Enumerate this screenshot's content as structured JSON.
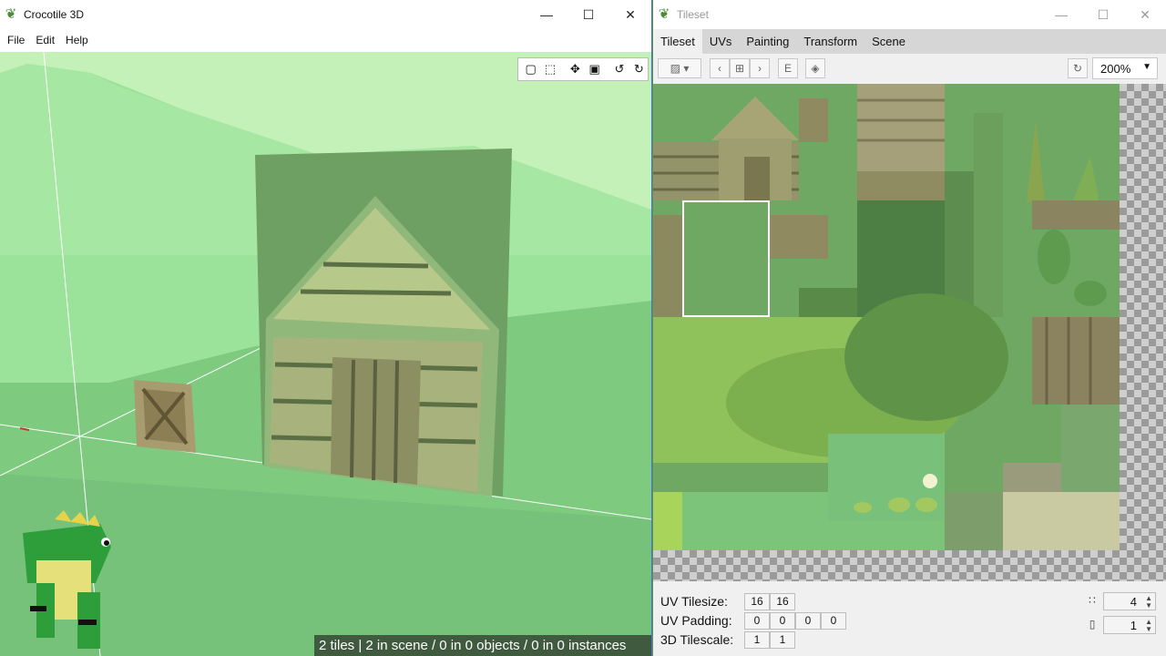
{
  "left_window": {
    "title": "Crocotile 3D",
    "menu": [
      "File",
      "Edit",
      "Help"
    ],
    "window_buttons": [
      "minimize-icon",
      "maximize-icon",
      "close-icon"
    ],
    "viewport_tools": [
      "square-icon",
      "cube-icon",
      "move-icon",
      "fill-square-icon",
      "rotate-ccw-icon",
      "rotate-cw-icon"
    ],
    "status": "2 tiles | 2 in scene / 0 in 0 objects / 0 in 0 instances",
    "colors": {
      "sky": "#9be39a",
      "ground": "#7ecb80",
      "status_bg": "#3f5a3f"
    }
  },
  "right_window": {
    "title": "Tileset",
    "window_buttons": [
      "minimize-icon",
      "maximize-icon",
      "close-icon"
    ],
    "tabs": [
      "Tileset",
      "UVs",
      "Painting",
      "Transform",
      "Scene"
    ],
    "active_tab": "Tileset",
    "toolbar_icons": [
      "image-dropdown-icon",
      "prev-icon",
      "grid-icon",
      "next-icon",
      "e-icon",
      "layers-icon",
      "refresh-icon"
    ],
    "zoom": "200%",
    "props": {
      "uv_tilesize_label": "UV Tilesize:",
      "uv_tilesize": [
        "16",
        "16"
      ],
      "uv_padding_label": "UV Padding:",
      "uv_padding": [
        "0",
        "0",
        "0",
        "0"
      ],
      "tilescale_label": "3D Tilescale:",
      "tilescale": [
        "1",
        "1"
      ]
    },
    "spinners": [
      {
        "icon": "dotted-grid-icon",
        "value": "4"
      },
      {
        "icon": "book-icon",
        "value": "1"
      }
    ]
  }
}
